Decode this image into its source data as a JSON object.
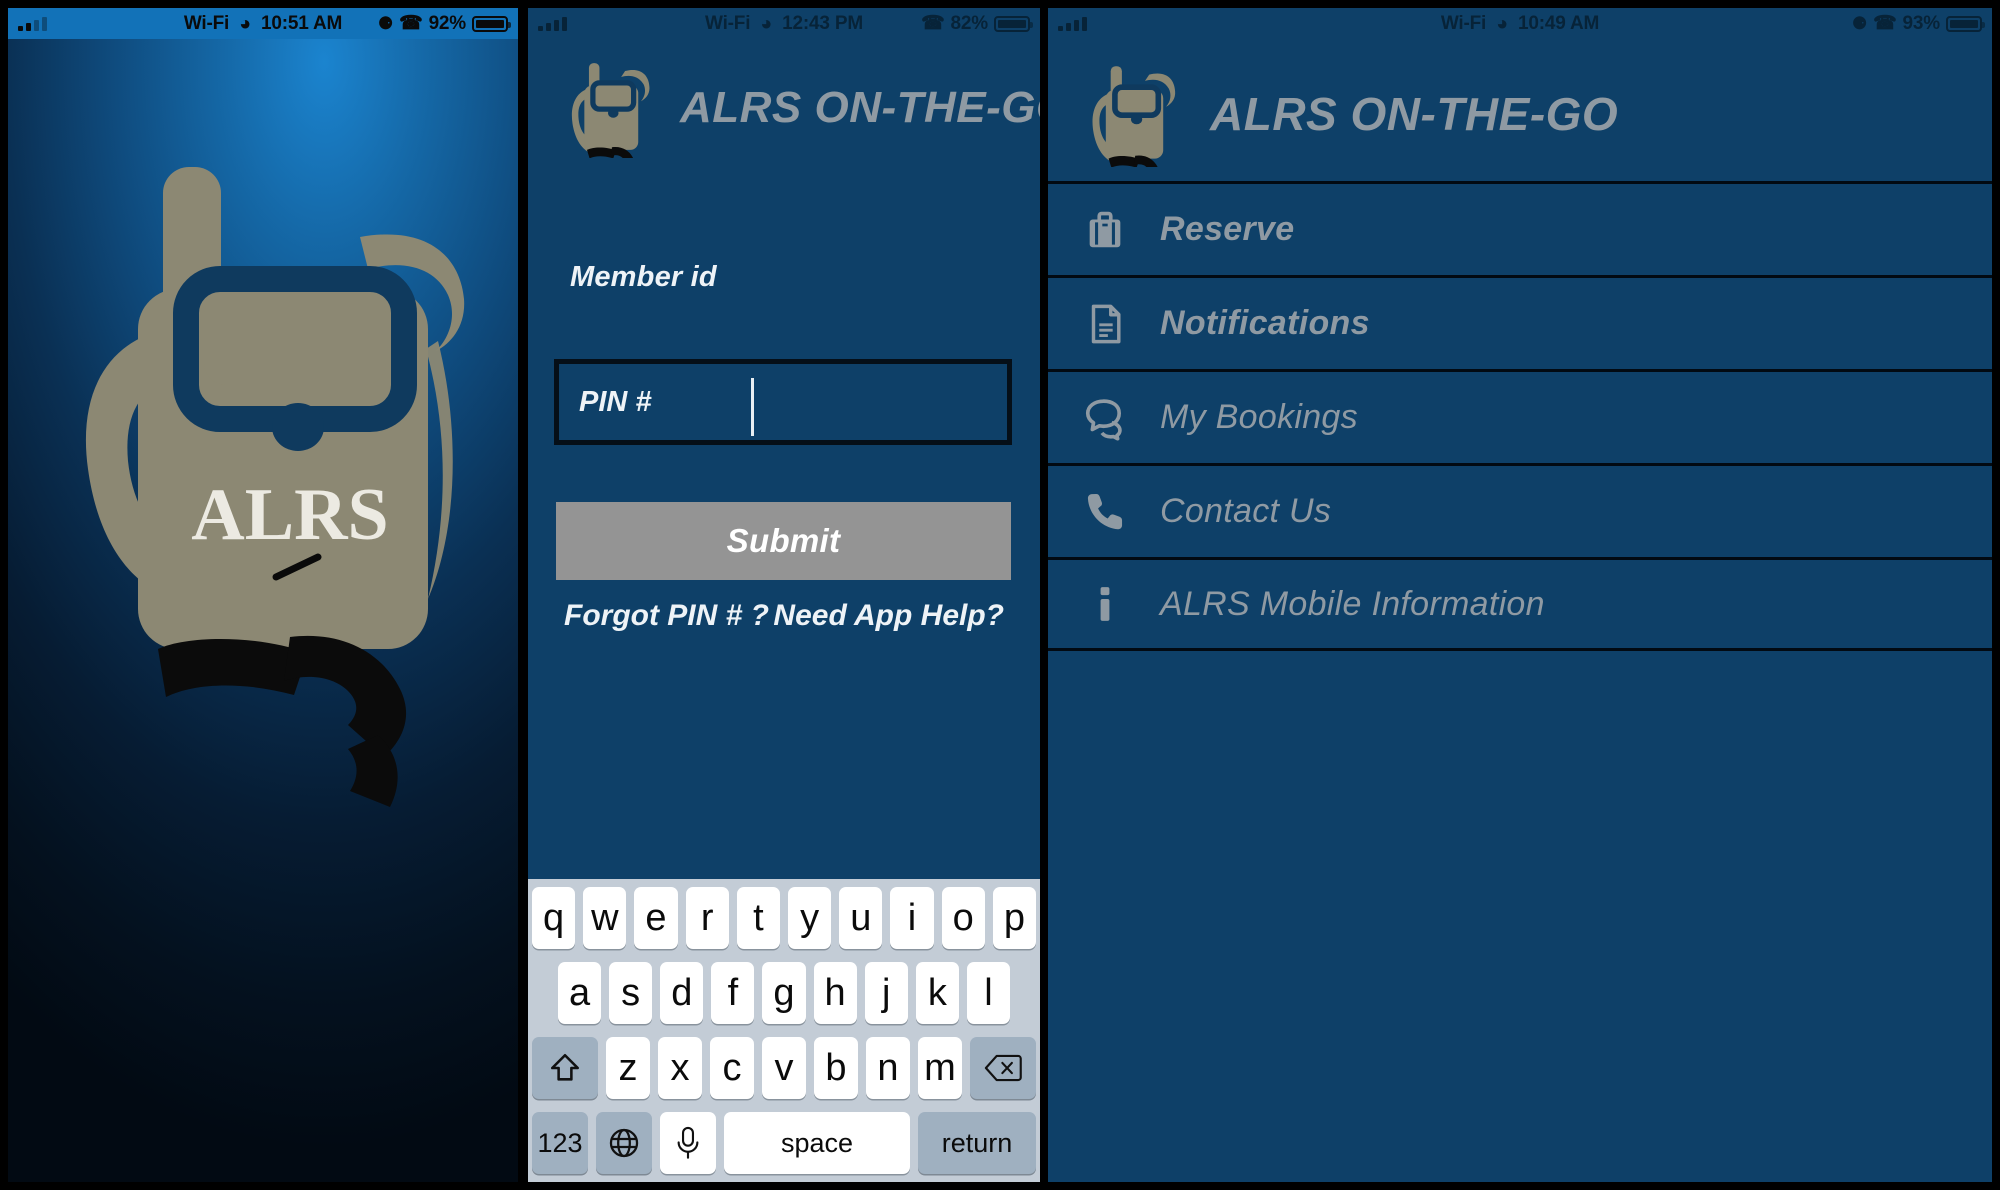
{
  "app": {
    "title": "ALRS ON-THE-GO",
    "logo_text": "ALRS",
    "brand_blue": "#0e4068",
    "brand_tan": "#8c8873",
    "accent_grey": "#8f9aa3"
  },
  "panels": [
    {
      "name": "splash"
    },
    {
      "name": "login"
    },
    {
      "name": "menu"
    }
  ],
  "status_bars": [
    {
      "carrier_label": "",
      "wifi_label": "Wi-Fi",
      "time": "10:51 AM",
      "battery_percent": "92%",
      "rotation_lock_icon": "rotation-lock-icon",
      "bluetooth_icon": "bluetooth-icon",
      "wifi_icon": "wifi-icon",
      "signal_icon": "signal-bars-icon",
      "battery_icon": "battery-icon"
    },
    {
      "carrier_label": "",
      "wifi_label": "Wi-Fi",
      "time": "12:43 PM",
      "battery_percent": "82%",
      "rotation_lock_icon": "",
      "bluetooth_icon": "bluetooth-icon",
      "wifi_icon": "wifi-icon",
      "signal_icon": "signal-bars-icon",
      "battery_icon": "battery-icon"
    },
    {
      "carrier_label": "",
      "wifi_label": "Wi-Fi",
      "time": "10:49 AM",
      "battery_percent": "93%",
      "rotation_lock_icon": "rotation-lock-icon",
      "bluetooth_icon": "bluetooth-icon",
      "wifi_icon": "wifi-icon",
      "signal_icon": "signal-bars-icon",
      "battery_icon": "battery-icon"
    }
  ],
  "login": {
    "header_title": "ALRS ON-THE-GO",
    "member_id_label": "Member id",
    "member_id_value": "",
    "pin_label": "PIN #",
    "pin_value": "",
    "pin_placeholder": "",
    "submit_label": "Submit",
    "forgot_pin_label": "Forgot PIN # ?",
    "need_help_label": "Need App Help?"
  },
  "keyboard": {
    "row1": [
      "q",
      "w",
      "e",
      "r",
      "t",
      "y",
      "u",
      "i",
      "o",
      "p"
    ],
    "row2": [
      "a",
      "s",
      "d",
      "f",
      "g",
      "h",
      "j",
      "k",
      "l"
    ],
    "row3": [
      "z",
      "x",
      "c",
      "v",
      "b",
      "n",
      "m"
    ],
    "shift_icon": "shift-arrow-icon",
    "backspace_icon": "backspace-delete-icon",
    "numbers_label": "123",
    "globe_icon": "globe-language-icon",
    "mic_icon": "microphone-icon",
    "space_label": "space",
    "return_label": "return"
  },
  "menu": {
    "header_title": "ALRS ON-THE-GO",
    "items": [
      {
        "label": "Reserve",
        "icon": "briefcase-icon",
        "bold": true
      },
      {
        "label": "Notifications",
        "icon": "document-icon",
        "bold": true
      },
      {
        "label": "My Bookings",
        "icon": "chat-bubbles-icon",
        "bold": false
      },
      {
        "label": "Contact Us",
        "icon": "phone-icon",
        "bold": false
      },
      {
        "label": "ALRS Mobile Information",
        "icon": "info-icon",
        "bold": false
      }
    ]
  }
}
